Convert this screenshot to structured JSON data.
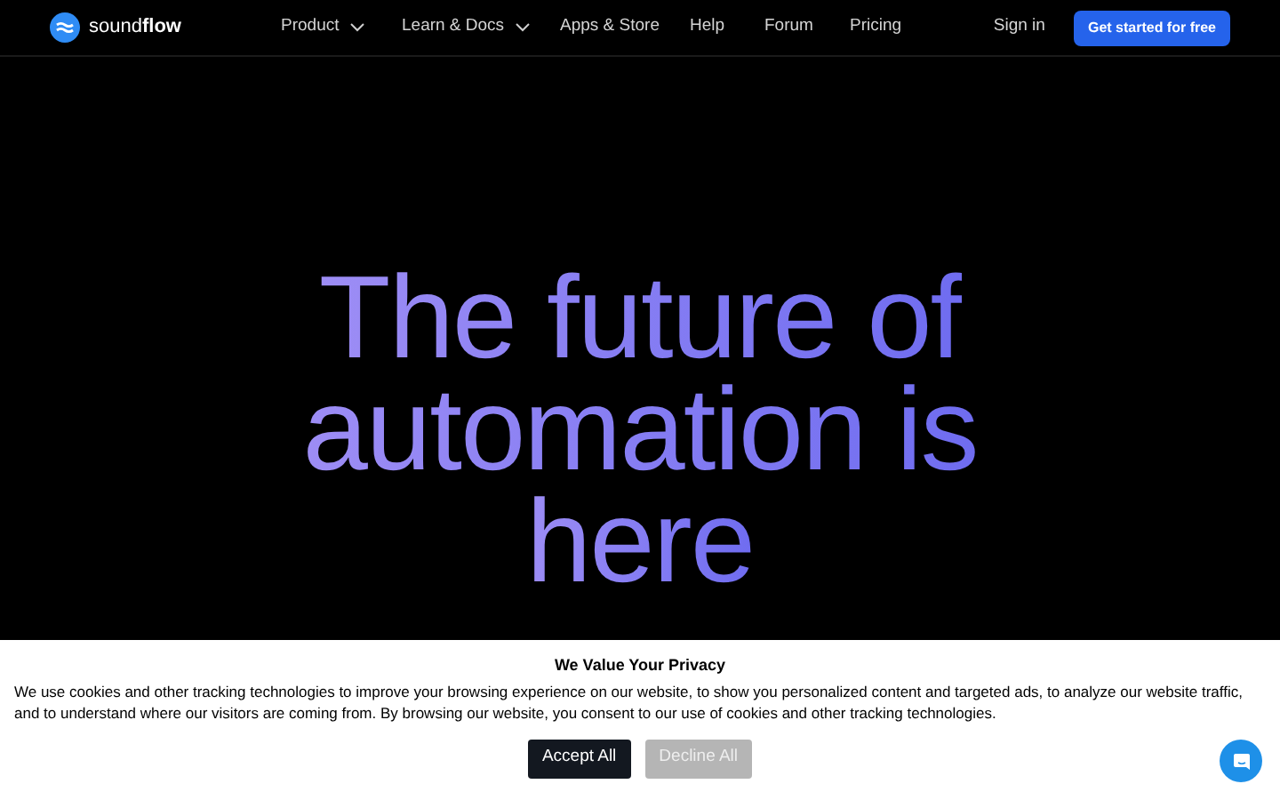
{
  "header": {
    "logo": "sound**flow**",
    "nav": [
      {
        "label": "Product",
        "dropdown": true
      },
      {
        "label": "Learn & Docs",
        "dropdown": true
      },
      {
        "label": "Apps & Store",
        "dropdown": false
      },
      {
        "label": "Help",
        "dropdown": false
      },
      {
        "label": "Forum",
        "dropdown": false
      },
      {
        "label": "Pricing",
        "dropdown": false
      }
    ],
    "sign_in": "Sign in",
    "cta": "Get started for free"
  },
  "hero": {
    "lines": [
      "The future of",
      "automation is",
      "here"
    ]
  },
  "cookie_banner": {
    "title": "We Value Your Privacy",
    "text": "We use cookies and other tracking technologies to improve your browsing experience on our website, to show you personalized content and targeted ads, to analyze our website traffic, and to understand where our visitors are coming from. By browsing our website, you consent to our use of cookies and other tracking technologies.",
    "buttons": [
      {
        "label": "Accept All",
        "disabled": false
      },
      {
        "label": "Decline All",
        "disabled": true
      }
    ]
  }
}
